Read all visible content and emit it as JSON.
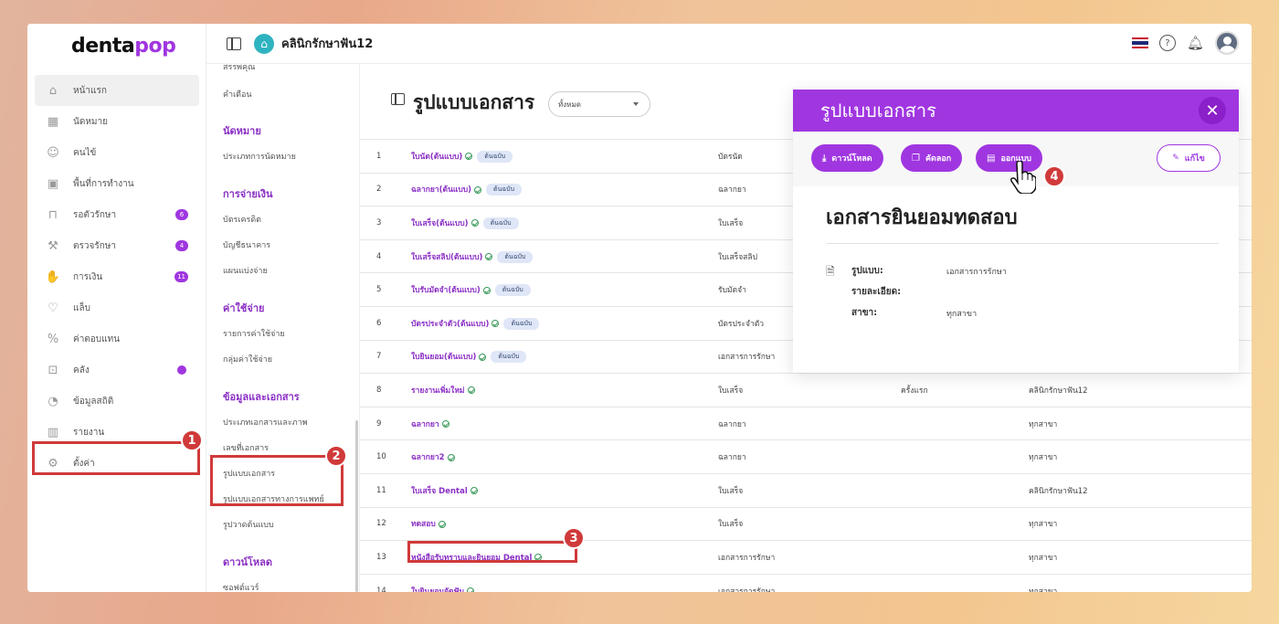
{
  "brand": {
    "logo_main": "denta",
    "logo_accent": "pop"
  },
  "topbar": {
    "clinic_name": "คลินิกรักษาฟัน12"
  },
  "sidebar": {
    "items": [
      {
        "label": "หน้าแรก",
        "icon": "home-icon",
        "active": true
      },
      {
        "label": "นัดหมาย",
        "icon": "calendar-icon"
      },
      {
        "label": "คนไข้",
        "icon": "user-icon"
      },
      {
        "label": "พื้นที่การทำงาน",
        "icon": "workspace-icon"
      },
      {
        "label": "รอตัวรักษา",
        "icon": "chair-icon",
        "badge": "6"
      },
      {
        "label": "ตรวจรักษา",
        "icon": "tools-icon",
        "badge": "4"
      },
      {
        "label": "การเงิน",
        "icon": "money-icon",
        "badge": "11"
      },
      {
        "label": "แล็บ",
        "icon": "tooth-icon"
      },
      {
        "label": "ค่าตอบแทน",
        "icon": "percent-icon"
      },
      {
        "label": "คลัง",
        "icon": "box-icon",
        "dot": true
      },
      {
        "label": "ข้อมูลสถิติ",
        "icon": "stats-icon"
      },
      {
        "label": "รายงาน",
        "icon": "report-icon"
      },
      {
        "label": "ตั้งค่า",
        "icon": "gear-icon"
      }
    ]
  },
  "submenu": {
    "top_items": [
      "สรรพคุณ",
      "คำเตือน"
    ],
    "groups": [
      {
        "title": "นัดหมาย",
        "items": [
          "ประเภทการนัดหมาย"
        ]
      },
      {
        "title": "การจ่ายเงิน",
        "items": [
          "บัตรเครดิต",
          "บัญชีธนาคาร",
          "แผนแบ่งจ่าย"
        ]
      },
      {
        "title": "ค่าใช้จ่าย",
        "items": [
          "รายการค่าใช้จ่าย",
          "กลุ่มค่าใช้จ่าย"
        ]
      },
      {
        "title": "ข้อมูลและเอกสาร",
        "items": [
          "ประเภทเอกสารและภาพ",
          "เลขที่เอกสาร",
          "รูปแบบเอกสาร",
          "รูปแบบเอกสารทางการแพทย์",
          "รูปวาดต้นแบบ"
        ]
      },
      {
        "title": "ดาวน์โหลด",
        "items": [
          "ซอฟต์แวร์"
        ]
      }
    ]
  },
  "main": {
    "title": "รูปแบบเอกสาร",
    "filter_value": "ทั้งหมด",
    "rows": [
      {
        "num": "1",
        "name": "ใบนัด(ต้นแบบ)",
        "tag": "ต้นฉบับ",
        "type": "บัตรนัด",
        "freq": "",
        "branch": ""
      },
      {
        "num": "2",
        "name": "ฉลากยา(ต้นแบบ)",
        "tag": "ต้นฉบับ",
        "type": "ฉลากยา",
        "freq": "",
        "branch": ""
      },
      {
        "num": "3",
        "name": "ใบเสร็จ(ต้นแบบ)",
        "tag": "ต้นฉบับ",
        "type": "ใบเสร็จ",
        "freq": "",
        "branch": ""
      },
      {
        "num": "4",
        "name": "ใบเสร็จสลิป(ต้นแบบ)",
        "tag": "ต้นฉบับ",
        "type": "ใบเสร็จสลิป",
        "freq": "",
        "branch": ""
      },
      {
        "num": "5",
        "name": "ใบรับมัดจำ(ต้นแบบ)",
        "tag": "ต้นฉบับ",
        "type": "รับมัดจำ",
        "freq": "",
        "branch": ""
      },
      {
        "num": "6",
        "name": "บัตรประจำตัว(ต้นแบบ)",
        "tag": "ต้นฉบับ",
        "type": "บัตรประจำตัว",
        "freq": "",
        "branch": ""
      },
      {
        "num": "7",
        "name": "ใบยินยอม(ต้นแบบ)",
        "tag": "ต้นฉบับ",
        "type": "เอกสารการรักษา",
        "freq": "",
        "branch": ""
      },
      {
        "num": "8",
        "name": "รายงานเพิ่มใหม่",
        "tag": "",
        "type": "ใบเสร็จ",
        "freq": "ครั้งแรก",
        "branch": "คลินิกรักษาฟัน12"
      },
      {
        "num": "9",
        "name": "ฉลากยา",
        "tag": "",
        "type": "ฉลากยา",
        "freq": "",
        "branch": "ทุกสาขา"
      },
      {
        "num": "10",
        "name": "ฉลากยา2",
        "tag": "",
        "type": "ฉลากยา",
        "freq": "",
        "branch": "ทุกสาขา"
      },
      {
        "num": "11",
        "name": "ใบเสร็จ Dental",
        "tag": "",
        "type": "ใบเสร็จ",
        "freq": "",
        "branch": "คลินิกรักษาฟัน12"
      },
      {
        "num": "12",
        "name": "ทดสอบ",
        "tag": "",
        "type": "ใบเสร็จ",
        "freq": "",
        "branch": "ทุกสาขา"
      },
      {
        "num": "13",
        "name": "หนังสือรับทราบและยินยอม Dental",
        "tag": "",
        "type": "เอกสารการรักษา",
        "freq": "",
        "branch": "ทุกสาขา"
      },
      {
        "num": "14",
        "name": "ใบยินยอมจัดฟัน",
        "tag": "",
        "type": "เอกสารการรักษา",
        "freq": "",
        "branch": "ทุกสาขา"
      }
    ]
  },
  "detail": {
    "header": "รูปแบบเอกสาร",
    "buttons": {
      "download": "ดาวน์โหลด",
      "copy": "คัดลอก",
      "design": "ออกแบบ",
      "edit": "แก้ไข"
    },
    "title": "เอกสารยินยอมทดสอบ",
    "fields": [
      {
        "label": "รูปแบบ:",
        "value": "เอกสารการรักษา"
      },
      {
        "label": "รายละเอียด:",
        "value": ""
      },
      {
        "label": "สาขา:",
        "value": "ทุกสาขา"
      }
    ]
  },
  "markers": [
    "1",
    "2",
    "3",
    "4"
  ],
  "colors": {
    "accent": "#a036e0",
    "marker": "#d03a3a"
  }
}
